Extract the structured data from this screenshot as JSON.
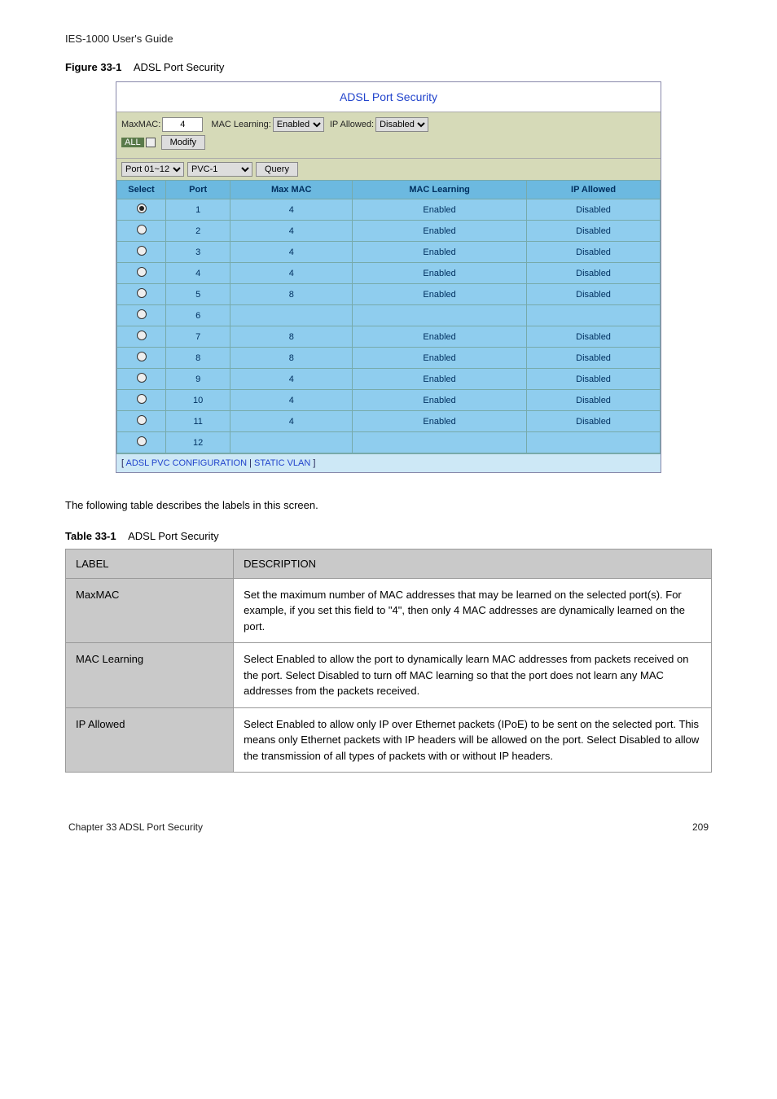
{
  "doc_header": "IES-1000 User's Guide",
  "figure_label_prefix": "Figure 33-1",
  "figure_label_text": "ADSL Port Security",
  "screenshot": {
    "title": "ADSL Port Security",
    "maxmac_label": "MaxMAC:",
    "maxmac_value": "4",
    "maclearning_label": "MAC Learning:",
    "maclearning_value": "Enabled",
    "ipallowed_label": "IP Allowed:",
    "ipallowed_value": "Disabled",
    "all_label": "ALL",
    "modify_btn": "Modify",
    "port_select": "Port 01~12",
    "pvc_select": "PVC-1",
    "query_btn": "Query",
    "columns": {
      "select": "Select",
      "port": "Port",
      "maxmac": "Max MAC",
      "maclearning": "MAC Learning",
      "ipallowed": "IP Allowed"
    },
    "rows": [
      {
        "selected": true,
        "port": "1",
        "maxmac": "4",
        "maclearn": "Enabled",
        "ipallow": "Disabled"
      },
      {
        "selected": false,
        "port": "2",
        "maxmac": "4",
        "maclearn": "Enabled",
        "ipallow": "Disabled"
      },
      {
        "selected": false,
        "port": "3",
        "maxmac": "4",
        "maclearn": "Enabled",
        "ipallow": "Disabled"
      },
      {
        "selected": false,
        "port": "4",
        "maxmac": "4",
        "maclearn": "Enabled",
        "ipallow": "Disabled"
      },
      {
        "selected": false,
        "port": "5",
        "maxmac": "8",
        "maclearn": "Enabled",
        "ipallow": "Disabled"
      },
      {
        "selected": false,
        "port": "6",
        "maxmac": "",
        "maclearn": "",
        "ipallow": ""
      },
      {
        "selected": false,
        "port": "7",
        "maxmac": "8",
        "maclearn": "Enabled",
        "ipallow": "Disabled"
      },
      {
        "selected": false,
        "port": "8",
        "maxmac": "8",
        "maclearn": "Enabled",
        "ipallow": "Disabled"
      },
      {
        "selected": false,
        "port": "9",
        "maxmac": "4",
        "maclearn": "Enabled",
        "ipallow": "Disabled"
      },
      {
        "selected": false,
        "port": "10",
        "maxmac": "4",
        "maclearn": "Enabled",
        "ipallow": "Disabled"
      },
      {
        "selected": false,
        "port": "11",
        "maxmac": "4",
        "maclearn": "Enabled",
        "ipallow": "Disabled"
      },
      {
        "selected": false,
        "port": "12",
        "maxmac": "",
        "maclearn": "",
        "ipallow": ""
      }
    ],
    "footer_bracket_open": "[ ",
    "footer_link1": "ADSL PVC CONFIGURATION",
    "footer_sep": " | ",
    "footer_link2": "STATIC VLAN",
    "footer_bracket_close": " ]"
  },
  "body_text": "The following table describes the labels in this screen.",
  "table_label_prefix": "Table 33-1",
  "table_label_text": "ADSL Port Security",
  "desc_table": {
    "h_label": "LABEL",
    "h_desc": "DESCRIPTION",
    "rows": [
      {
        "label": "MaxMAC",
        "desc": "Set the maximum number of MAC addresses that may be learned on the selected port(s). For example, if you set this field to \"4\", then only 4 MAC addresses are dynamically learned on the port."
      },
      {
        "label": "MAC Learning",
        "desc": "Select Enabled to allow the port to dynamically learn MAC addresses from packets received on the port. Select Disabled to turn off MAC learning so that the port does not learn any MAC addresses from the packets received."
      },
      {
        "label": "IP Allowed",
        "desc": "Select Enabled to allow only IP over Ethernet packets (IPoE) to be sent on the selected port. This means only Ethernet packets with IP headers will be allowed on the port. Select Disabled to allow the transmission of all types of packets with or without IP headers."
      }
    ]
  },
  "footer_left": "Chapter 33 ADSL Port Security",
  "footer_right": "209"
}
